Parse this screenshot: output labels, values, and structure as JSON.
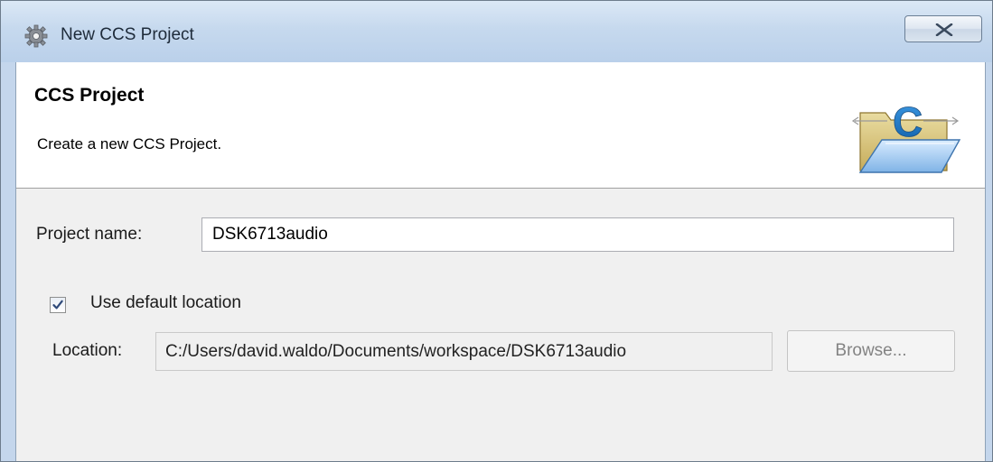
{
  "window": {
    "title": "New CCS Project",
    "app_icon": "gear-icon",
    "close_icon": "close-icon"
  },
  "header": {
    "title": "CCS Project",
    "description": "Create a new CCS Project.",
    "icon": "folder-c-icon"
  },
  "form": {
    "project_name_label": "Project name:",
    "project_name_value": "DSK6713audio",
    "use_default_location_label": "Use default location",
    "use_default_location_checked": true,
    "location_label": "Location:",
    "location_value": "C:/Users/david.waldo/Documents/workspace/DSK6713audio",
    "browse_label": "Browse..."
  },
  "colors": {
    "titlebar": "#c6d9ee",
    "frame_border": "#8ea2b8",
    "dialog_bg": "#f0f0f0"
  }
}
